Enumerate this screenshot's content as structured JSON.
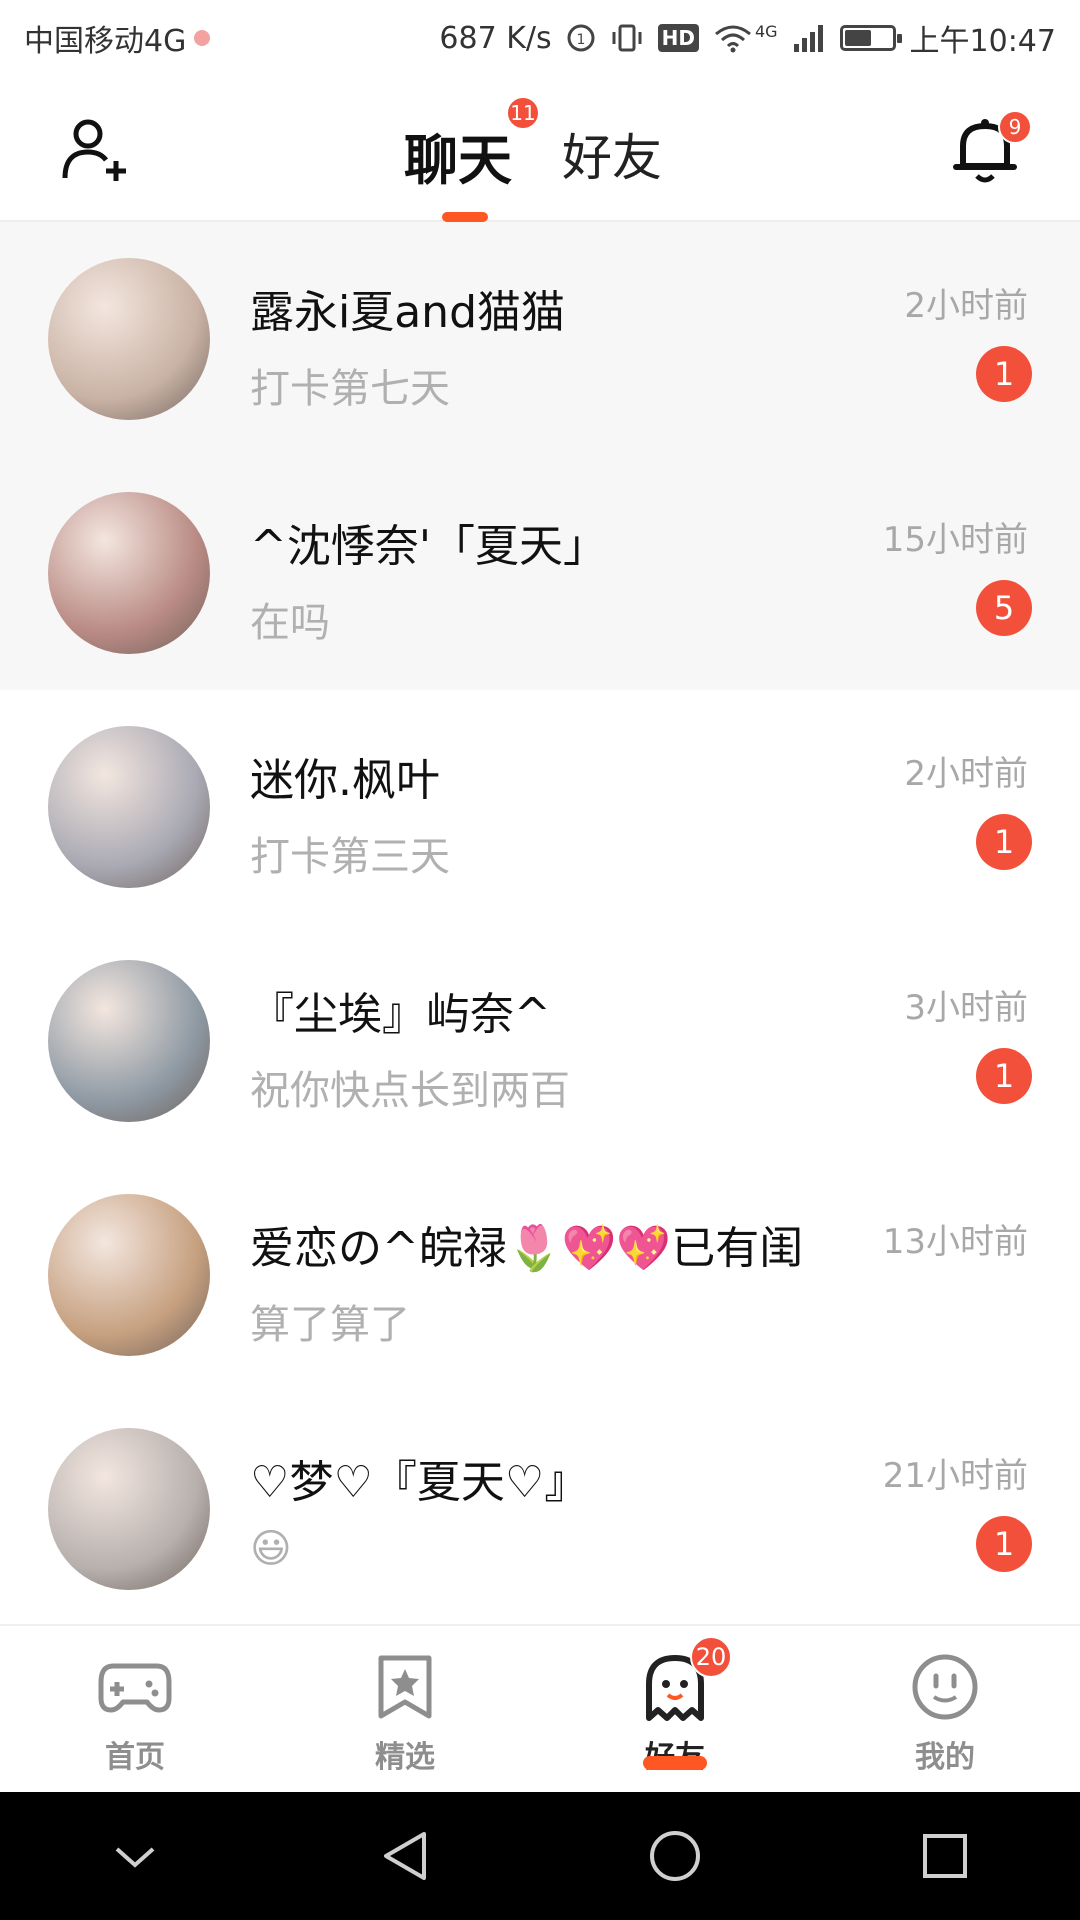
{
  "theme": {
    "accent": "#ff5722",
    "badge": "#f2503a"
  },
  "status_bar": {
    "carrier": "中国移动4G",
    "speed": "687 K/s",
    "hd": "HD",
    "network": "4G",
    "time": "上午10:47",
    "battery_level": 0.55
  },
  "header": {
    "tabs": [
      {
        "label": "聊天",
        "active": true,
        "badge": "11"
      },
      {
        "label": "好友",
        "active": false
      }
    ],
    "notification_badge": "9"
  },
  "chats": [
    {
      "name": "露永i夏and猫猫",
      "preview": "打卡第七天",
      "time": "2小时前",
      "unread": "1",
      "pinned": true,
      "avatar_color": "#c9b2a4"
    },
    {
      "name": "^沈悸奈'「夏天」",
      "preview": "在吗",
      "time": "15小时前",
      "unread": "5",
      "pinned": true,
      "avatar_color": "#b98a84"
    },
    {
      "name": "迷你.枫叶",
      "preview": "打卡第三天",
      "time": "2小时前",
      "unread": "1",
      "pinned": false,
      "avatar_color": "#a9a9b3"
    },
    {
      "name": "『尘埃』屿奈^",
      "preview": "祝你快点长到两百",
      "time": "3小时前",
      "unread": "1",
      "pinned": false,
      "avatar_color": "#8f9aa4"
    },
    {
      "name": "爱恋の^皖禄🌷💖💖已有闺",
      "preview": "算了算了",
      "time": "13小时前",
      "unread": "",
      "pinned": false,
      "avatar_color": "#c6a07f"
    },
    {
      "name": "♡梦♡『夏天♡』",
      "preview": "😃",
      "time": "21小时前",
      "unread": "1",
      "pinned": false,
      "avatar_color": "#b7b0ad"
    }
  ],
  "bottom_nav": [
    {
      "label": "首页",
      "icon": "gamepad-icon",
      "active": false
    },
    {
      "label": "精选",
      "icon": "star-bookmark-icon",
      "active": false
    },
    {
      "label": "好友",
      "icon": "ghost-icon",
      "active": true,
      "badge": "20"
    },
    {
      "label": "我的",
      "icon": "smiley-icon",
      "active": false
    }
  ],
  "system_nav": [
    "chevron-down-icon",
    "back-triangle-icon",
    "home-circle-icon",
    "recents-square-icon"
  ]
}
